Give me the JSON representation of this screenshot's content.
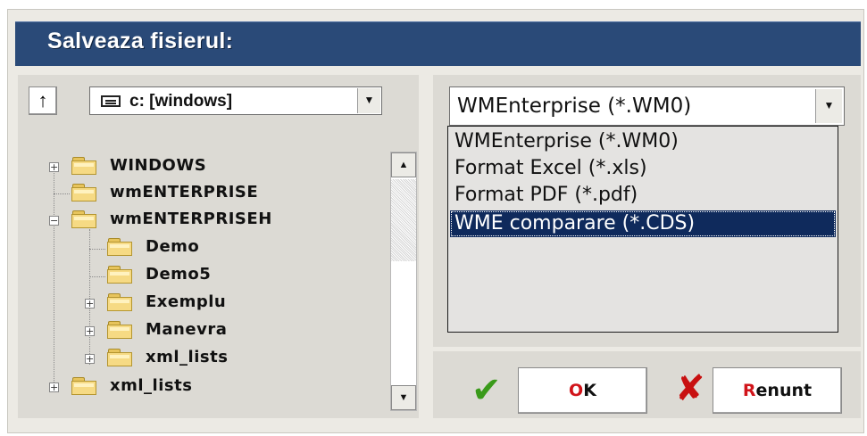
{
  "dialog": {
    "title": "Salveaza fisierul:"
  },
  "navigation": {
    "up_icon": "arrow-up-icon",
    "drive_icon": "drive-icon",
    "drive_value": "c: [windows]"
  },
  "tree": {
    "items": [
      {
        "label": "WINDOWS",
        "expander": "+"
      },
      {
        "label": "wmENTERPRISE",
        "expander": ""
      },
      {
        "label": "wmENTERPRISEH",
        "expander": "−"
      },
      {
        "label": "Demo",
        "expander": ""
      },
      {
        "label": "Demo5",
        "expander": ""
      },
      {
        "label": "Exemplu",
        "expander": "+"
      },
      {
        "label": "Manevra",
        "expander": "+"
      },
      {
        "label": "xml_lists",
        "expander": "+"
      },
      {
        "label": "xml_lists",
        "expander": "+"
      }
    ]
  },
  "format": {
    "selected_value": "WMEnterprise (*.WM0)",
    "options": [
      "WMEnterprise (*.WM0)",
      "Format Excel (*.xls)",
      "Format PDF (*.pdf)",
      "WME comparare (*.CDS)"
    ],
    "highlighted_index": 3
  },
  "buttons": {
    "ok_accel": "O",
    "ok_rest": "K",
    "cancel_accel": "R",
    "cancel_rest": "enunt",
    "ok_icon": "checkmark-icon",
    "cancel_icon": "x-mark-icon"
  },
  "colors": {
    "title_bar": "#2a4a78",
    "selection": "#0f2a5c",
    "accelerator": "#d1141a",
    "ok_icon": "#3a9a1a",
    "cancel_icon": "#c81010"
  }
}
